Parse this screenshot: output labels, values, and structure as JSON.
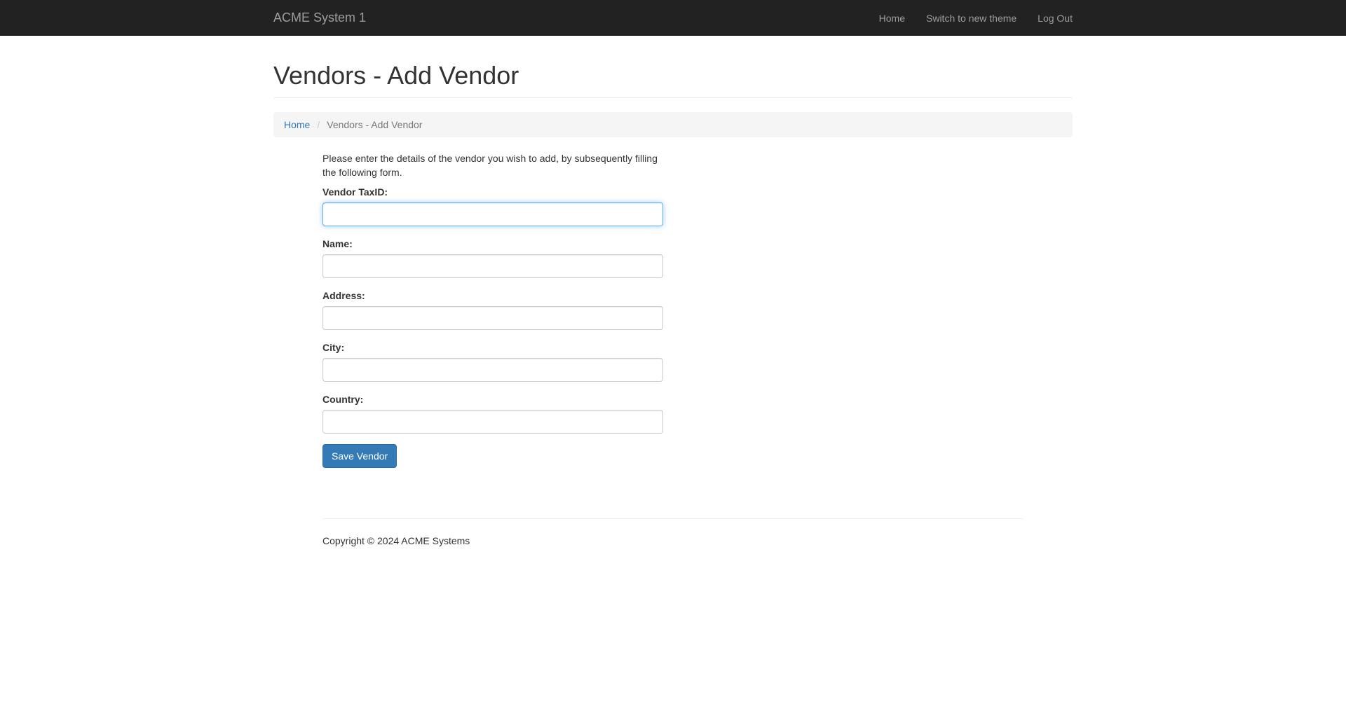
{
  "navbar": {
    "brand": "ACME System 1",
    "links": [
      {
        "label": "Home"
      },
      {
        "label": "Switch to new theme"
      },
      {
        "label": "Log Out"
      }
    ]
  },
  "page": {
    "title": "Vendors - Add Vendor"
  },
  "breadcrumb": {
    "home": "Home",
    "separator": "/",
    "current": "Vendors - Add Vendor"
  },
  "form": {
    "intro": "Please enter the details of the vendor you wish to add, by subsequently filling the following form.",
    "fields": [
      {
        "label": "Vendor TaxID:",
        "value": "",
        "focused": true
      },
      {
        "label": "Name:",
        "value": ""
      },
      {
        "label": "Address:",
        "value": ""
      },
      {
        "label": "City:",
        "value": ""
      },
      {
        "label": "Country:",
        "value": ""
      }
    ],
    "submit_label": "Save Vendor"
  },
  "footer": {
    "copyright": "Copyright © 2024 ACME Systems"
  },
  "colors": {
    "navbar_bg": "#222222",
    "nav_text": "#9d9d9d",
    "link": "#337ab7",
    "primary_button": "#337ab7",
    "focus_border": "#66afe9"
  }
}
